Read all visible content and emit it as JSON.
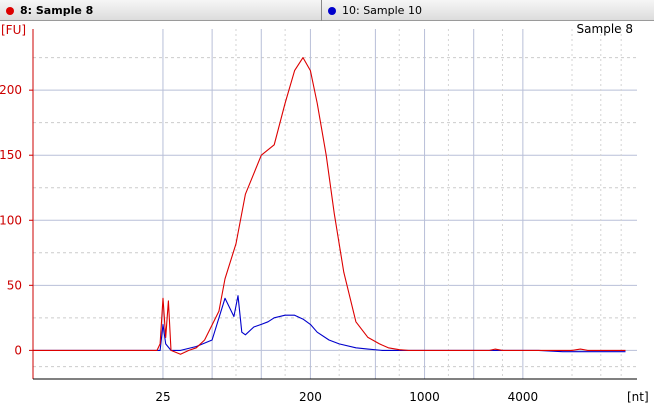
{
  "tabs": [
    {
      "label": "8: Sample 8",
      "color": "#dd0000",
      "active": true
    },
    {
      "label": "10: Sample 10",
      "color": "#0000cc",
      "active": false
    }
  ],
  "chart_data": {
    "type": "line",
    "title": "Sample 8",
    "ylabel": "[FU]",
    "xlabel": "[nt]",
    "y_ticks": [
      0,
      50,
      100,
      150,
      200
    ],
    "ylim": [
      -22,
      247
    ],
    "x_tick_labels": [
      {
        "label": "25",
        "nt": 25
      },
      {
        "label": "200",
        "nt": 200
      },
      {
        "label": "1000",
        "nt": 1000
      },
      {
        "label": "4000",
        "nt": 4000
      }
    ],
    "x_gridlines_nt": [
      25,
      50,
      100,
      200,
      500,
      1000,
      2000,
      4000
    ],
    "xlim_nt": [
      4,
      20000
    ],
    "grid": true,
    "series": [
      {
        "name": "8: Sample 8",
        "color": "#dd0000",
        "x": [
          4,
          23,
          24,
          25,
          26,
          27,
          28,
          32,
          36,
          40,
          45,
          55,
          60,
          70,
          80,
          100,
          120,
          140,
          160,
          180,
          200,
          220,
          250,
          280,
          320,
          380,
          450,
          530,
          600,
          700,
          800,
          1000,
          1500,
          2000,
          2500,
          2700,
          3000,
          4000,
          5000,
          6000,
          7000,
          8000,
          9000,
          10000,
          11000,
          12000,
          14000,
          17000
        ],
        "values": [
          0,
          0,
          5,
          40,
          10,
          38,
          0,
          -3,
          0,
          2,
          8,
          30,
          55,
          82,
          120,
          150,
          158,
          190,
          215,
          225,
          215,
          190,
          150,
          105,
          60,
          22,
          10,
          5,
          2,
          0.5,
          0,
          0,
          0,
          0,
          0,
          1,
          0,
          0,
          0,
          0,
          0,
          0,
          1,
          0,
          0,
          0,
          0,
          0
        ]
      },
      {
        "name": "10: Sample 10",
        "color": "#0000cc",
        "x": [
          4,
          23,
          24,
          25,
          26,
          28,
          32,
          40,
          50,
          60,
          68,
          72,
          76,
          80,
          90,
          100,
          110,
          120,
          140,
          160,
          180,
          200,
          220,
          260,
          300,
          380,
          450,
          550,
          700,
          1000,
          2000,
          3000,
          5000,
          7000,
          9000,
          11000,
          14000,
          17000
        ],
        "values": [
          0,
          0,
          0,
          20,
          5,
          0,
          0,
          3,
          8,
          40,
          26,
          42,
          14,
          12,
          18,
          20,
          22,
          25,
          27,
          27,
          24,
          20,
          14,
          8,
          5,
          2,
          1,
          0,
          0,
          0,
          0,
          0,
          0,
          -1,
          -1,
          -1,
          -1,
          -1
        ]
      }
    ]
  }
}
